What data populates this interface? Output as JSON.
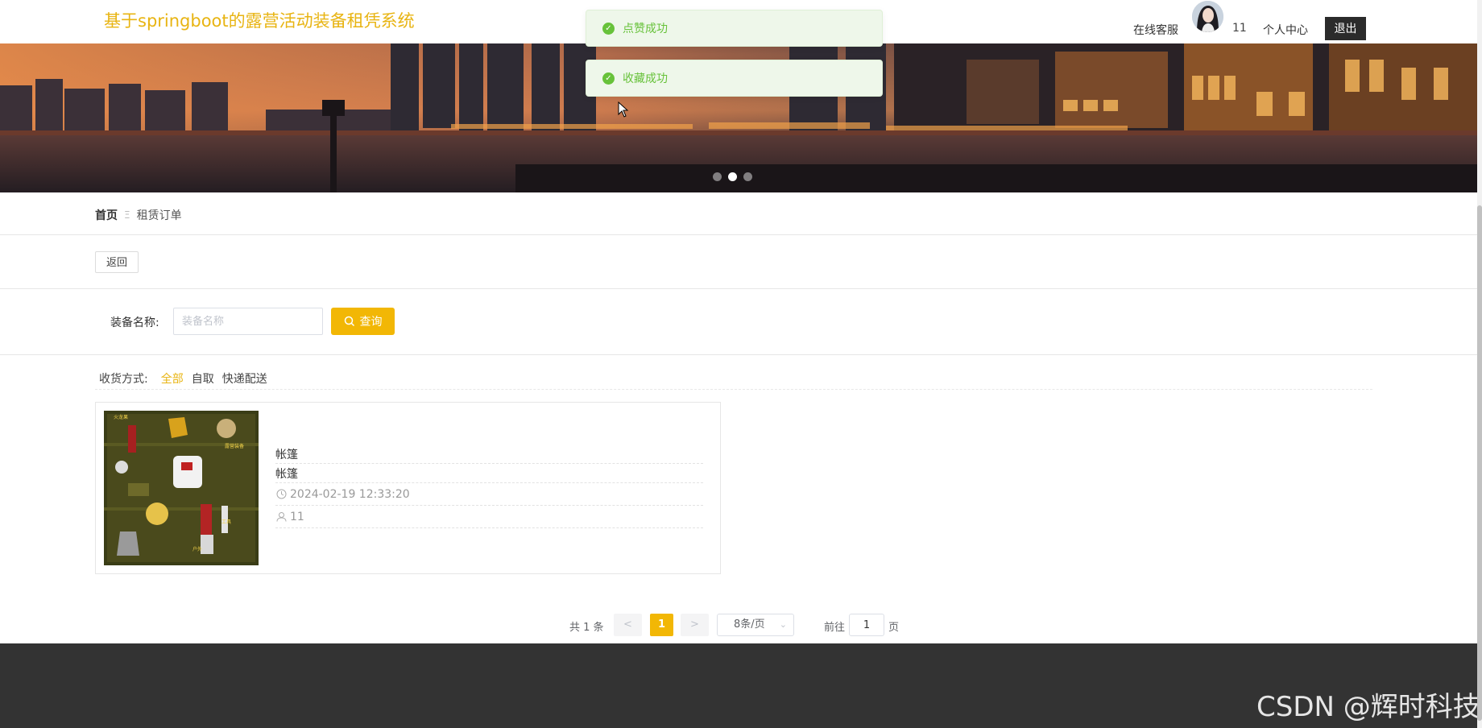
{
  "header": {
    "site_title": "基于springboot的露营活动装备租凭系统",
    "service_label": "在线客服",
    "username": "11",
    "center_label": "个人中心",
    "logout_label": "退出"
  },
  "toasts": [
    {
      "text": "点赞成功",
      "icon": "check-circle-icon"
    },
    {
      "text": "收藏成功",
      "icon": "check-circle-icon"
    }
  ],
  "banner": {
    "slides": 3,
    "active_slide": 1
  },
  "breadcrumb": {
    "home": "首页",
    "separator": "Ξ",
    "current": "租赁订单"
  },
  "back_button": "返回",
  "search": {
    "label": "装备名称:",
    "placeholder": "装备名称",
    "value": "",
    "button": "查询"
  },
  "filter": {
    "label": "收货方式:",
    "options": [
      "全部",
      "自取",
      "快递配送"
    ],
    "selected": "全部"
  },
  "items": [
    {
      "name": "帐篷",
      "category": "帐篷",
      "time": "2024-02-19 12:33:20",
      "user": "11"
    }
  ],
  "pagination": {
    "total_text": "共 1 条",
    "prev": "<",
    "next": ">",
    "current_page": "1",
    "page_size": "8条/页",
    "goto_label": "前往",
    "goto_value": "1",
    "goto_unit": "页"
  },
  "watermark": "CSDN @辉时科技",
  "colors": {
    "accent": "#f2b705",
    "title": "#e8b412",
    "success": "#67c23a",
    "footer": "#333333"
  }
}
